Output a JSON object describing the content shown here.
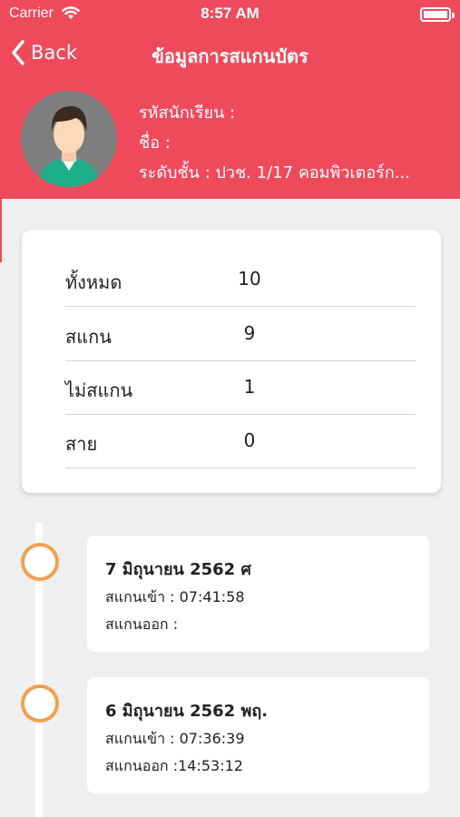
{
  "status_bar": {
    "carrier": "Carrier",
    "time": "8:57 AM",
    "wifi_icon": "wifi-icon",
    "battery_icon": "battery-icon"
  },
  "nav": {
    "back_label": "Back",
    "back_icon": "chevron-left-icon",
    "title": "ข้อมูลการสแกนบัตร"
  },
  "profile": {
    "avatar_icon": "user-avatar-icon",
    "student_id": "รหัสนักเรียน :",
    "name": "ชื่อ :",
    "level": "ระดับชั้น : ปวช. 1/17 คอมพิวเตอร์ก..."
  },
  "summary": {
    "rows": [
      {
        "label": "ทั้งหมด",
        "value": "10"
      },
      {
        "label": "สแกน",
        "value": "9"
      },
      {
        "label": "ไม่สแกน",
        "value": "1"
      },
      {
        "label": "สาย",
        "value": "0"
      }
    ]
  },
  "timeline": {
    "entries": [
      {
        "date": "7 มิถุนายน 2562 ศ",
        "scan_in": "สแกนเข้า : 07:41:58",
        "scan_out": "สแกนออก :"
      },
      {
        "date": "6 มิถุนายน 2562 พฤ.",
        "scan_in": "สแกนเข้า : 07:36:39",
        "scan_out": "สแกนออก :14:53:12"
      }
    ]
  },
  "colors": {
    "header_bg": "#ef4a5c",
    "timeline_node": "#f2a053",
    "page_bg": "#efefef"
  }
}
